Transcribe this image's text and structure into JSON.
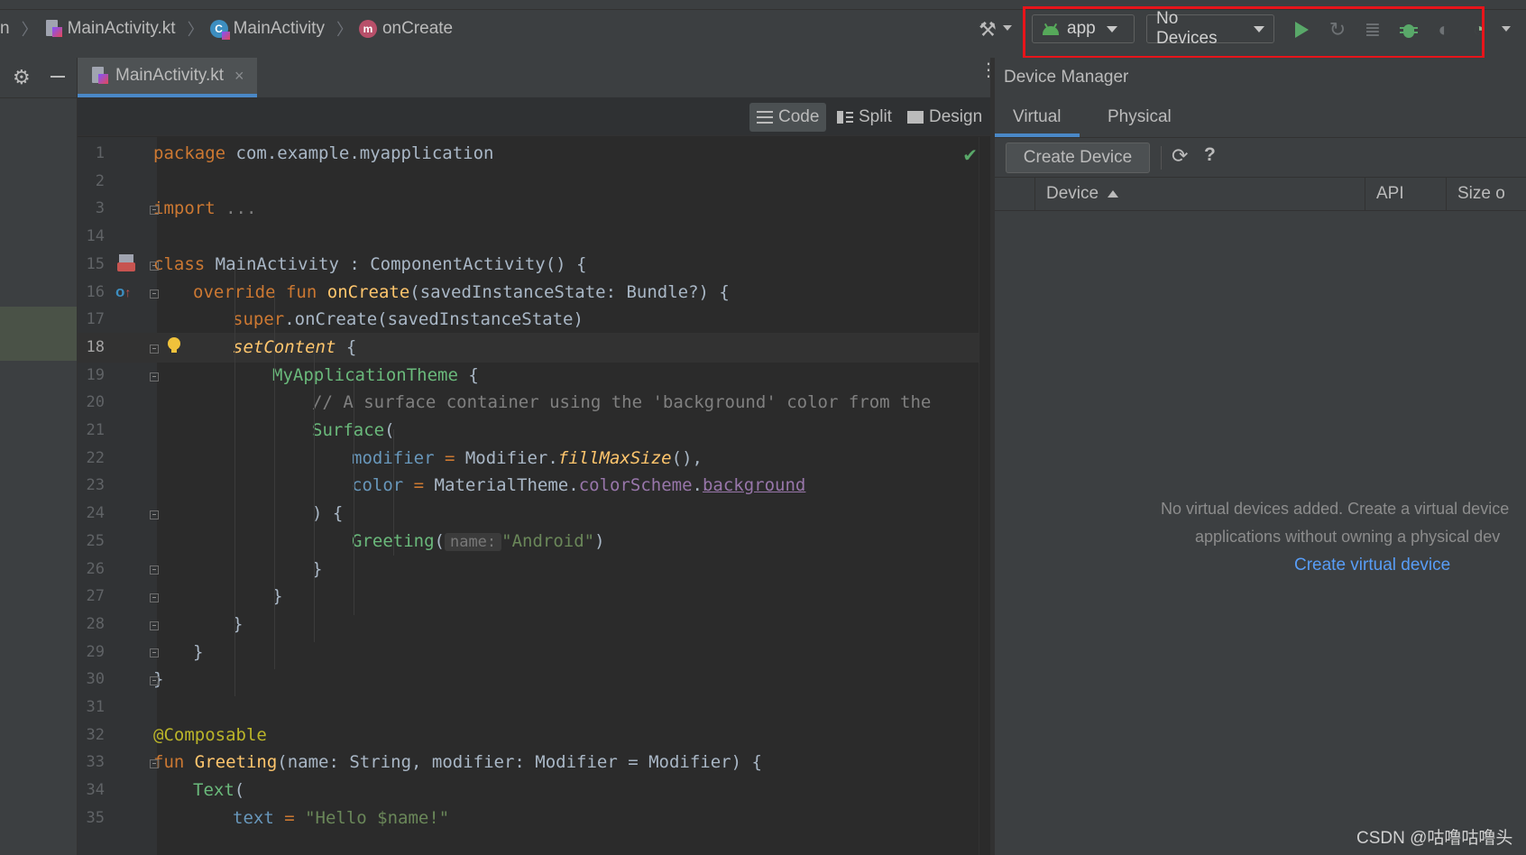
{
  "breadcrumb": {
    "partial_start": "n",
    "file": "MainActivity.kt",
    "class": "MainActivity",
    "method": "onCreate"
  },
  "toolbar": {
    "run_config": "app",
    "device_selector": "No Devices"
  },
  "editor": {
    "tab_label": "MainActivity.kt",
    "tab_close": "×",
    "modes": [
      "Code",
      "Split",
      "Design"
    ],
    "active_mode": "Code"
  },
  "code_lines": [
    {
      "num": "1"
    },
    {
      "num": "2"
    },
    {
      "num": "3"
    },
    {
      "num": "14"
    },
    {
      "num": "15"
    },
    {
      "num": "16"
    },
    {
      "num": "17"
    },
    {
      "num": "18"
    },
    {
      "num": "19"
    },
    {
      "num": "20"
    },
    {
      "num": "21"
    },
    {
      "num": "22"
    },
    {
      "num": "23"
    },
    {
      "num": "24"
    },
    {
      "num": "25"
    },
    {
      "num": "26"
    },
    {
      "num": "27"
    },
    {
      "num": "28"
    },
    {
      "num": "29"
    },
    {
      "num": "30"
    },
    {
      "num": "31"
    },
    {
      "num": "32"
    },
    {
      "num": "33"
    },
    {
      "num": "34"
    },
    {
      "num": "35"
    }
  ],
  "code": {
    "l1": [
      "package",
      " com.example.myapplication"
    ],
    "l3": [
      "import",
      " ..."
    ],
    "l15": [
      "class",
      " MainActivity : ComponentActivity() {"
    ],
    "l16": [
      "override",
      " ",
      "fun",
      " ",
      "onCreate",
      "(savedInstanceState: Bundle?) {"
    ],
    "l17": [
      "super",
      ".onCreate(savedInstanceState)"
    ],
    "l18": [
      "setContent",
      " {"
    ],
    "l19": [
      "MyApplicationTheme",
      " {"
    ],
    "l20": "// A surface container using the 'background' color from the",
    "l21": [
      "Surface",
      "("
    ],
    "l22": [
      "modifier",
      " = ",
      "Modifier.",
      "fillMaxSize",
      "(),"
    ],
    "l23": [
      "color",
      " = ",
      "MaterialTheme.",
      "colorScheme",
      ".",
      "background"
    ],
    "l24": ") {",
    "l25": [
      "Greeting",
      "(",
      "name:",
      "\"Android\"",
      ")"
    ],
    "l26": "}",
    "l27": "}",
    "l28": "}",
    "l29": "}",
    "l30": "}",
    "l32": "@Composable",
    "l33": [
      "fun",
      " ",
      "Greeting",
      "(name: String, modifier: Modifier = Modifier) {"
    ],
    "l34": [
      "Text",
      "("
    ],
    "l35": [
      "text",
      " = ",
      "\"Hello $name!\""
    ]
  },
  "device_manager": {
    "title": "Device Manager",
    "tabs": [
      "Virtual",
      "Physical"
    ],
    "active_tab": "Virtual",
    "create_button": "Create Device",
    "help": "?",
    "columns": [
      "Device",
      "API",
      "Size o"
    ],
    "empty_line1": "No virtual devices added. Create a virtual device",
    "empty_line2": "applications without owning a physical dev",
    "empty_link": "Create virtual device"
  },
  "watermark": "CSDN @咕噜咕噜头",
  "colors": {
    "highlight_box": "#e8141a",
    "run_green": "#59a869",
    "link_blue": "#589df6",
    "tab_underline": "#4a88c7"
  }
}
